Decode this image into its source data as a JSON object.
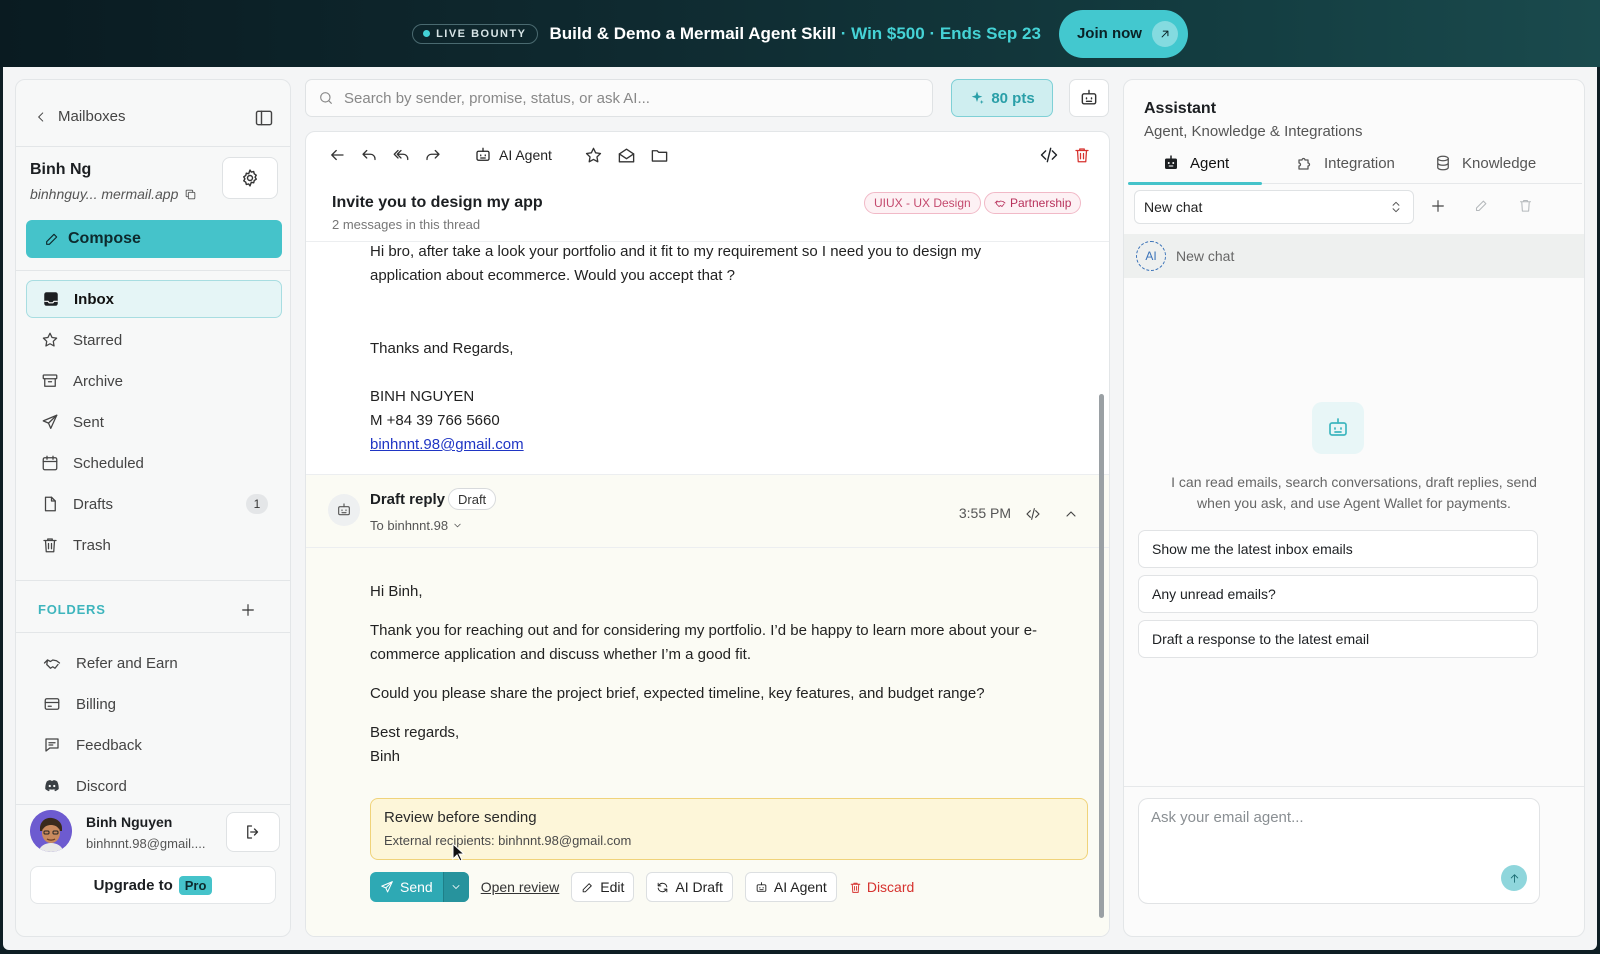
{
  "banner": {
    "badge": "LIVE BOUNTY",
    "headline": "Build & Demo a Mermail Agent Skill",
    "separator1": " · ",
    "prize": "Win $500",
    "separator2": " · ",
    "deadline": "Ends Sep 23",
    "cta": "Join now"
  },
  "sidebar": {
    "back_label": "Mailboxes",
    "account_name": "Binh Ng",
    "account_email": "binhnguy... mermail.app",
    "compose_label": "Compose",
    "nav": [
      {
        "label": "Inbox",
        "icon": "inbox-icon",
        "active": true
      },
      {
        "label": "Starred",
        "icon": "star-icon"
      },
      {
        "label": "Archive",
        "icon": "archive-icon"
      },
      {
        "label": "Sent",
        "icon": "send-icon"
      },
      {
        "label": "Scheduled",
        "icon": "calendar-icon"
      },
      {
        "label": "Drafts",
        "icon": "file-icon",
        "count": "1"
      },
      {
        "label": "Trash",
        "icon": "trash-icon"
      }
    ],
    "folders_label": "FOLDERS",
    "links": [
      {
        "label": "Refer and Earn",
        "icon": "handshake-icon"
      },
      {
        "label": "Billing",
        "icon": "credit-card-icon"
      },
      {
        "label": "Feedback",
        "icon": "message-icon"
      },
      {
        "label": "Discord",
        "icon": "discord-icon"
      }
    ],
    "user": {
      "name": "Binh Nguyen",
      "email": "binhnnt.98@gmail...."
    },
    "upgrade_label": "Upgrade to",
    "upgrade_badge": "Pro"
  },
  "search": {
    "placeholder": "Search by sender, promise, status, or ask AI..."
  },
  "points": "80 pts",
  "email": {
    "toolbar_agent_label": "AI Agent",
    "title": "Invite you to design my app",
    "thread_count": "2 messages in this thread",
    "tags": [
      "UIUX - UX Design",
      "Partnership"
    ],
    "message": {
      "line1": "Hi bro, after take a look your portfolio and it fit to my requirement so I need you to design my",
      "line2": "application about ecommerce. Would you accept that ?",
      "signoff": "Thanks and Regards,",
      "sig_name": "BINH NGUYEN",
      "sig_phone": "M +84 39 766 5660",
      "sig_email": "binhnnt.98@gmail.com"
    },
    "draft": {
      "title": "Draft reply",
      "badge": "Draft",
      "to": "To binhnnt.98",
      "time": "3:55 PM",
      "greeting": "Hi Binh,",
      "p1_line1": "Thank you for reaching out and for considering my portfolio. I’d be happy to learn more about your e-",
      "p1_line2": "commerce application and discuss whether I’m a good fit.",
      "p2": "Could you please share the project brief, expected timeline, key features, and budget range?",
      "closing": "Best regards,",
      "sign": "Binh"
    },
    "review": {
      "title": "Review before sending",
      "sub": "External recipients: binhnnt.98@gmail.com"
    },
    "actions": {
      "send": "Send",
      "open_review": "Open review",
      "edit": "Edit",
      "ai_draft": "AI Draft",
      "ai_agent": "AI Agent",
      "discard": "Discard"
    }
  },
  "assistant": {
    "title": "Assistant",
    "subtitle": "Agent, Knowledge & Integrations",
    "tabs": [
      "Agent",
      "Integration",
      "Knowledge"
    ],
    "chat_select": "New chat",
    "chat_row": "New chat",
    "ai_badge": "AI",
    "empty_text": "I can read emails, search conversations, draft replies, send when you ask, and use Agent Wallet for payments.",
    "suggestions": [
      "Show me the latest inbox emails",
      "Any unread emails?",
      "Draft a response to the latest email"
    ],
    "ask_placeholder": "Ask your email agent..."
  },
  "colors": {
    "accent": "#45c3ca",
    "danger": "#d6322e",
    "tag_pink": "#c44a6e",
    "banner_highlight": "#45d3d6"
  }
}
